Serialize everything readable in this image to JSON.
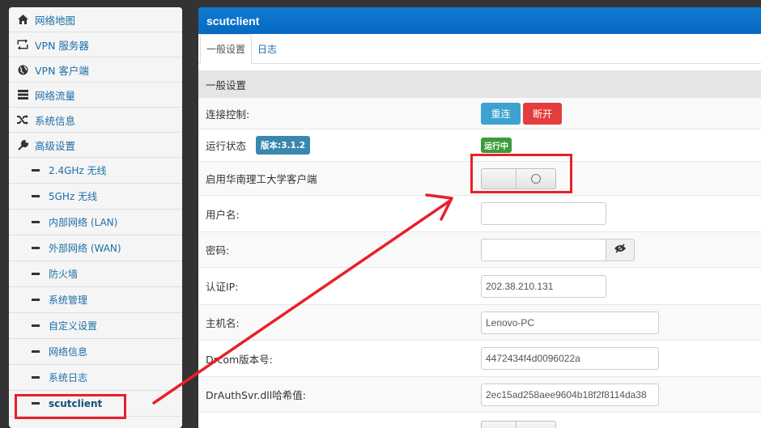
{
  "sidebar": {
    "items": [
      {
        "label": "网络地图",
        "icon": "home-icon"
      },
      {
        "label": "VPN 服务器",
        "icon": "retweet-icon"
      },
      {
        "label": "VPN 客户端",
        "icon": "globe-icon"
      },
      {
        "label": "网络流量",
        "icon": "list-icon"
      },
      {
        "label": "系统信息",
        "icon": "random-icon"
      },
      {
        "label": "高级设置",
        "icon": "wrench-icon"
      }
    ],
    "subitems": [
      {
        "label": "2.4GHz 无线"
      },
      {
        "label": "5GHz 无线"
      },
      {
        "label": "内部网络 (LAN)"
      },
      {
        "label": "外部网络 (WAN)"
      },
      {
        "label": "防火墙"
      },
      {
        "label": "系统管理"
      },
      {
        "label": "自定义设置"
      },
      {
        "label": "网络信息"
      },
      {
        "label": "系统日志"
      },
      {
        "label": "scutclient",
        "active": true
      }
    ]
  },
  "panel": {
    "title": "scutclient",
    "tabs": [
      {
        "label": "一般设置",
        "active": true
      },
      {
        "label": "日志"
      }
    ],
    "section_title": "一般设置",
    "rows": {
      "connection": {
        "label": "连接控制:",
        "reconnect_label": "重连",
        "disconnect_label": "断开"
      },
      "status": {
        "label": "运行状态",
        "version_badge": "版本:3.1.2",
        "status_badge": "运行中"
      },
      "enable": {
        "label": "启用华南理工大学客户端",
        "enabled": false
      },
      "username": {
        "label": "用户名:",
        "value": ""
      },
      "password": {
        "label": "密码:",
        "value": ""
      },
      "auth_ip": {
        "label": "认证IP:",
        "value": "202.38.210.131"
      },
      "hostname": {
        "label": "主机名:",
        "value": "Lenovo-PC"
      },
      "drcom_version": {
        "label": "Drcom版本号:",
        "value": "4472434f4d0096022a"
      },
      "drauth_hash": {
        "label": "DrAuthSvr.dll哈希值:",
        "value": "2ec15ad258aee9604b18f2f8114da38"
      }
    }
  },
  "colors": {
    "header_blue": "#0669c0",
    "link_blue": "#1a6ea8",
    "reconnect_button": "#3ea2d0",
    "disconnect_button": "#e43d3d",
    "badge_blue": "#3a87ad",
    "badge_green": "#3a9b3a",
    "annotation_red": "#e8202a"
  }
}
